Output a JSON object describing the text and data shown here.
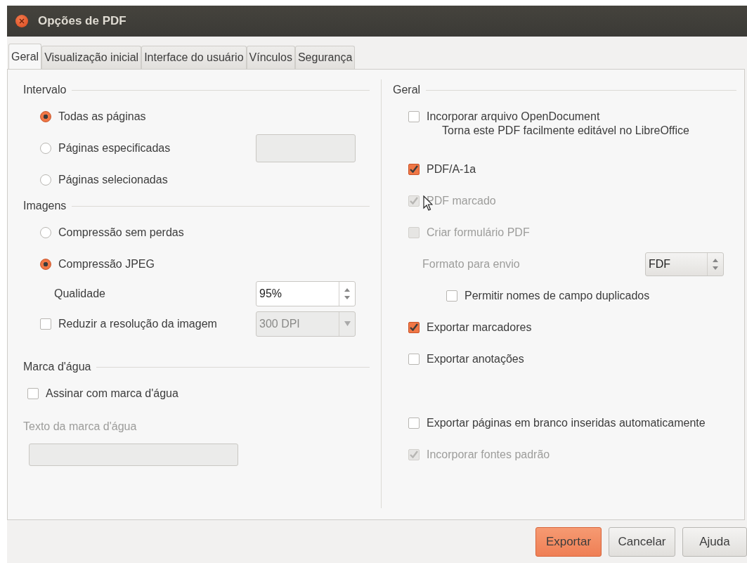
{
  "window": {
    "title": "Opções de PDF"
  },
  "tabs": [
    {
      "label": "Geral",
      "selected": true
    },
    {
      "label": "Visualização inicial",
      "selected": false
    },
    {
      "label": "Interface do usuário",
      "selected": false
    },
    {
      "label": "Vínculos",
      "selected": false
    },
    {
      "label": "Segurança",
      "selected": false
    }
  ],
  "left_sections": [
    {
      "title": "Intervalo",
      "items": [
        {
          "kind": "radio",
          "label": "Todas as páginas",
          "selected": true
        },
        {
          "kind": "radio",
          "label": "Páginas especificadas",
          "selected": false,
          "field": {
            "disabled": true
          }
        },
        {
          "kind": "radio",
          "label": "Páginas selecionadas",
          "selected": false
        }
      ]
    },
    {
      "title": "Imagens",
      "items": [
        {
          "kind": "radio",
          "label": "Compressão sem perdas",
          "selected": false
        },
        {
          "kind": "radio",
          "label": "Compressão JPEG",
          "selected": true,
          "children": [
            {
              "kind": "spin",
              "label": "Qualidade",
              "value": "95%",
              "disabled": false
            }
          ]
        },
        {
          "kind": "checkbox",
          "label": "Reduzir a resolução da imagem",
          "checked": false,
          "disabled": false,
          "dropdown": {
            "value": "300 DPI",
            "disabled": true
          }
        }
      ]
    },
    {
      "title": "Marca d'água",
      "items": [
        {
          "kind": "checkbox",
          "label": "Assinar com marca d'água",
          "checked": false,
          "disabled": false
        },
        {
          "kind": "text",
          "label": "Texto da marca d'água",
          "disabled": true
        }
      ]
    }
  ],
  "right_section": {
    "title": "Geral",
    "groups": [
      [
        {
          "kind": "checkbox",
          "label": "Incorporar arquivo OpenDocument",
          "checked": false,
          "disabled": false,
          "note": "Torna este PDF facilmente editável no LibreOffice"
        }
      ],
      [
        {
          "kind": "checkbox",
          "label": "PDF/A-1a",
          "checked": true,
          "disabled": false
        },
        {
          "kind": "checkbox",
          "label": "PDF marcado",
          "checked": true,
          "disabled": true
        },
        {
          "kind": "checkbox",
          "label": "Criar formulário PDF",
          "checked": false,
          "disabled": true,
          "children": [
            {
              "kind": "select",
              "label": "Formato para envio",
              "value": "FDF",
              "disabled": true
            },
            {
              "kind": "checkbox",
              "label": "Permitir nomes de campo duplicados",
              "checked": false,
              "disabled": false
            }
          ]
        },
        {
          "kind": "checkbox",
          "label": "Exportar marcadores",
          "checked": true,
          "disabled": false
        },
        {
          "kind": "checkbox",
          "label": "Exportar anotações",
          "checked": false,
          "disabled": false
        }
      ],
      [
        {
          "kind": "checkbox",
          "label": "Exportar páginas em branco inseridas automaticamente",
          "checked": false,
          "disabled": false
        },
        {
          "kind": "checkbox",
          "label": "Incorporar fontes padrão",
          "checked": true,
          "disabled": true
        }
      ]
    ]
  },
  "buttons": [
    {
      "label": "Exportar",
      "default": true
    },
    {
      "label": "Cancelar",
      "default": false
    },
    {
      "label": "Ajuda",
      "default": false
    }
  ]
}
